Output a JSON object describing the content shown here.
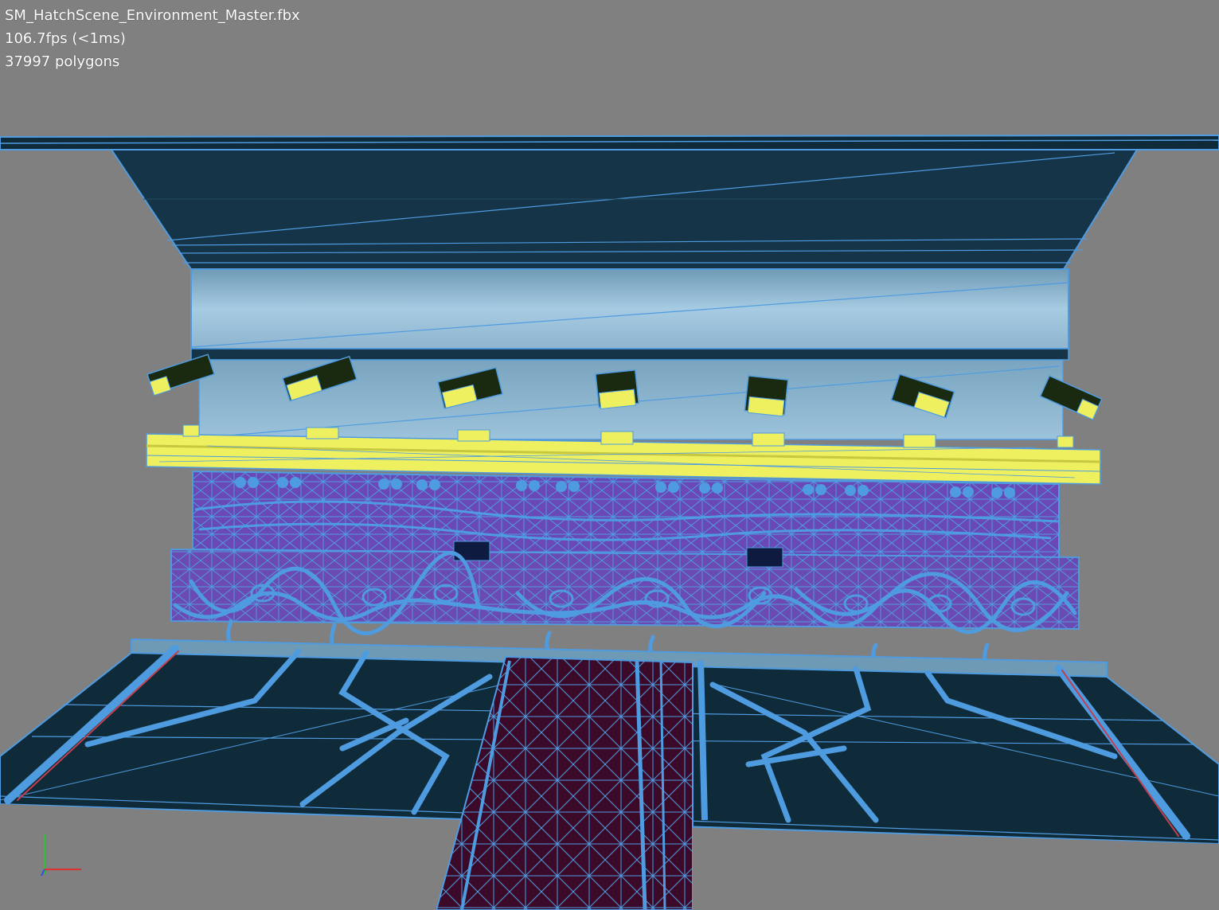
{
  "viewport": {
    "file_name": "SM_HatchScene_Environment_Master.fbx",
    "fps_readout": "106.7fps (<1ms)",
    "polygon_readout": "37997 polygons"
  },
  "colors": {
    "background": "#808080",
    "wire": "#4f9be0",
    "panel_dark": "#0f2a38",
    "wall_light": "#a6cbe2",
    "highlight_yellow": "#eef060",
    "purple": "#6a4ab8",
    "walkway": "#3a0a28"
  },
  "axis_gizmo": {
    "x_axis_color": "#e03030",
    "y_axis_color": "#30c030",
    "z_axis_color": "#3050e0"
  }
}
